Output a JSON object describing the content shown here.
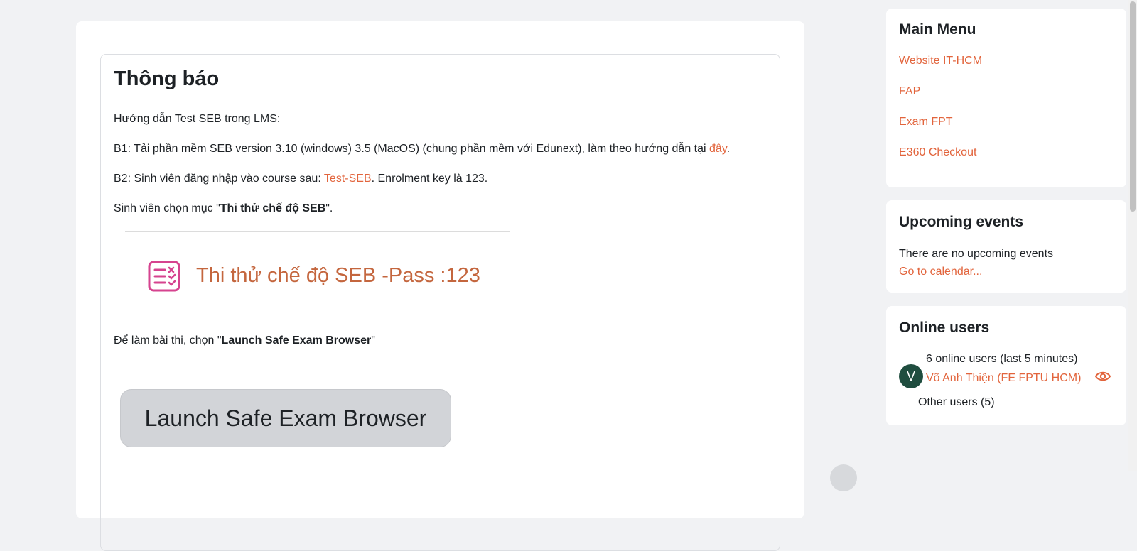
{
  "notice": {
    "title": "Thông báo",
    "intro": "Hướng dẫn Test SEB trong LMS:",
    "step1_text": "B1: Tải phần mềm SEB version 3.10 (windows) 3.5 (MacOS) (chung phần mềm với Edunext), làm theo hướng dẫn tại ",
    "step1_link": "đây",
    "step1_end": ".",
    "step2_text": "B2: Sinh viên đăng nhập vào course sau: ",
    "step2_link": "Test-SEB",
    "step2_end": ". Enrolment key là 123.",
    "choose_prefix": "Sinh viên chọn mục \"",
    "choose_bold": "Thi thử chế độ SEB",
    "choose_suffix": "\".",
    "quiz_title": "Thi thử chế độ SEB -Pass :123",
    "exam_prefix": "Để làm bài thi, chọn \"",
    "exam_bold": "Launch Safe Exam Browser",
    "exam_suffix": "\"",
    "launch_button": "Launch Safe Exam Browser"
  },
  "main_menu": {
    "title": "Main Menu",
    "links": [
      "Website IT-HCM",
      "FAP",
      "Exam FPT",
      "E360 Checkout"
    ]
  },
  "upcoming_events": {
    "title": "Upcoming events",
    "empty_text": "There are no upcoming events",
    "calendar_link": "Go to calendar..."
  },
  "online_users": {
    "title": "Online users",
    "summary": "6 online users (last 5 minutes)",
    "avatar_initial": "V",
    "user_name": "Võ Anh Thiện (FE FPTU HCM)",
    "other_users": "Other users (5)"
  },
  "colors": {
    "link": "#e2643c",
    "quiz_icon": "#d6438f",
    "avatar_bg": "#1f4d3f"
  }
}
